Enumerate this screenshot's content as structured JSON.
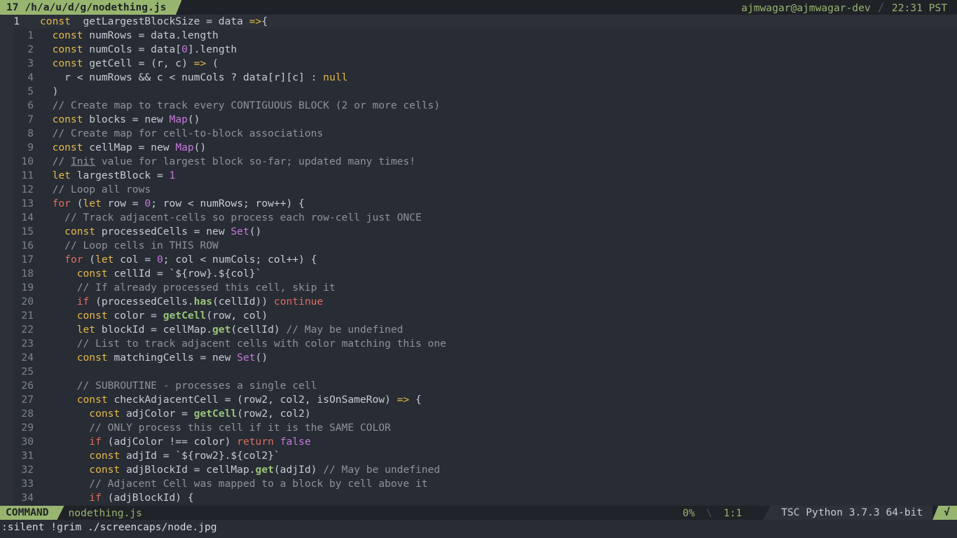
{
  "topbar": {
    "tab_label": "17 /h/a/u/d/g/nodething.js",
    "user_host": "ajmwagar@ajmwagar-dev",
    "separator": "/",
    "time": "22:31 PST"
  },
  "statusbar": {
    "mode": "COMMAND",
    "filename": "nodething.js",
    "percent": "0%",
    "separator": "\\",
    "position": "1:1",
    "lsp_info": "TSC Python 3.7.3 64-bit",
    "check": "√"
  },
  "command_line": ":silent !grim ./screencaps/node.jpg",
  "colors": {
    "accent_green": "#98b56f",
    "background": "#282c34",
    "keyword": "#e5b94a",
    "comment": "#8e939b",
    "number_class": "#c678dd",
    "control": "#e06c5f",
    "method": "#98c379"
  },
  "code": {
    "lines": [
      {
        "num": "1",
        "tokens": [
          [
            "kw",
            "const"
          ],
          [
            "",
            "  getLargestBlockSize = data "
          ],
          [
            "op",
            "=>"
          ],
          [
            "",
            "{"
          ]
        ]
      },
      {
        "num": "1",
        "tokens": [
          [
            "",
            "  "
          ],
          [
            "kw",
            "const"
          ],
          [
            "",
            " numRows = data.length"
          ]
        ]
      },
      {
        "num": "2",
        "tokens": [
          [
            "",
            "  "
          ],
          [
            "kw",
            "const"
          ],
          [
            "",
            " numCols = data["
          ],
          [
            "num",
            "0"
          ],
          [
            "",
            "].length"
          ]
        ]
      },
      {
        "num": "3",
        "tokens": [
          [
            "",
            "  "
          ],
          [
            "kw",
            "const"
          ],
          [
            "",
            " getCell = (r, c) "
          ],
          [
            "op",
            "=>"
          ],
          [
            "",
            " ("
          ]
        ]
      },
      {
        "num": "4",
        "tokens": [
          [
            "",
            "    r < numRows && c < numCols ? data[r][c] : "
          ],
          [
            "kw",
            "null"
          ]
        ]
      },
      {
        "num": "5",
        "tokens": [
          [
            "",
            "  )"
          ]
        ]
      },
      {
        "num": "6",
        "tokens": [
          [
            "",
            "  "
          ],
          [
            "cm",
            "// Create map to track every CONTIGUOUS BLOCK (2 or more cells)"
          ]
        ]
      },
      {
        "num": "7",
        "tokens": [
          [
            "",
            "  "
          ],
          [
            "kw",
            "const"
          ],
          [
            "",
            " blocks = new "
          ],
          [
            "cls",
            "Map"
          ],
          [
            "",
            "()"
          ]
        ]
      },
      {
        "num": "8",
        "tokens": [
          [
            "",
            "  "
          ],
          [
            "cm",
            "// Create map for cell-to-block associations"
          ]
        ]
      },
      {
        "num": "9",
        "tokens": [
          [
            "",
            "  "
          ],
          [
            "kw",
            "const"
          ],
          [
            "",
            " cellMap = new "
          ],
          [
            "cls",
            "Map"
          ],
          [
            "",
            "()"
          ]
        ]
      },
      {
        "num": "10",
        "tokens": [
          [
            "",
            "  "
          ],
          [
            "cm",
            "// "
          ],
          [
            "cm ul",
            "Init"
          ],
          [
            "cm",
            " value for largest block so-far; updated many times!"
          ]
        ]
      },
      {
        "num": "11",
        "tokens": [
          [
            "",
            "  "
          ],
          [
            "kw",
            "let"
          ],
          [
            "",
            " largestBlock = "
          ],
          [
            "num",
            "1"
          ]
        ]
      },
      {
        "num": "12",
        "tokens": [
          [
            "",
            "  "
          ],
          [
            "cm",
            "// Loop all rows"
          ]
        ]
      },
      {
        "num": "13",
        "tokens": [
          [
            "",
            "  "
          ],
          [
            "ctl",
            "for"
          ],
          [
            "",
            " ("
          ],
          [
            "kw",
            "let"
          ],
          [
            "",
            " row = "
          ],
          [
            "num",
            "0"
          ],
          [
            "",
            "; row < numRows; row++) {"
          ]
        ]
      },
      {
        "num": "14",
        "tokens": [
          [
            "",
            "    "
          ],
          [
            "cm",
            "// Track adjacent-cells so process each row-cell just ONCE"
          ]
        ]
      },
      {
        "num": "15",
        "tokens": [
          [
            "",
            "    "
          ],
          [
            "kw",
            "const"
          ],
          [
            "",
            " processedCells = new "
          ],
          [
            "cls",
            "Set"
          ],
          [
            "",
            "()"
          ]
        ]
      },
      {
        "num": "16",
        "tokens": [
          [
            "",
            "    "
          ],
          [
            "cm",
            "// Loop cells in THIS ROW"
          ]
        ]
      },
      {
        "num": "17",
        "tokens": [
          [
            "",
            "    "
          ],
          [
            "ctl",
            "for"
          ],
          [
            "",
            " ("
          ],
          [
            "kw",
            "let"
          ],
          [
            "",
            " col = "
          ],
          [
            "num",
            "0"
          ],
          [
            "",
            "; col < numCols; col++) {"
          ]
        ]
      },
      {
        "num": "18",
        "tokens": [
          [
            "",
            "      "
          ],
          [
            "kw",
            "const"
          ],
          [
            "",
            " cellId = `${row}.${col}`"
          ]
        ]
      },
      {
        "num": "19",
        "tokens": [
          [
            "",
            "      "
          ],
          [
            "cm",
            "// If already processed this cell, skip it"
          ]
        ]
      },
      {
        "num": "20",
        "tokens": [
          [
            "",
            "      "
          ],
          [
            "ctl",
            "if"
          ],
          [
            "",
            " (processedCells."
          ],
          [
            "method",
            "has"
          ],
          [
            "",
            "(cellId)) "
          ],
          [
            "ctl",
            "continue"
          ]
        ]
      },
      {
        "num": "21",
        "tokens": [
          [
            "",
            "      "
          ],
          [
            "kw",
            "const"
          ],
          [
            "",
            " color = "
          ],
          [
            "method",
            "getCell"
          ],
          [
            "",
            "(row, col)"
          ]
        ]
      },
      {
        "num": "22",
        "tokens": [
          [
            "",
            "      "
          ],
          [
            "kw",
            "let"
          ],
          [
            "",
            " blockId = cellMap."
          ],
          [
            "method",
            "get"
          ],
          [
            "",
            "(cellId) "
          ],
          [
            "cm",
            "// May be undefined"
          ]
        ]
      },
      {
        "num": "23",
        "tokens": [
          [
            "",
            "      "
          ],
          [
            "cm",
            "// List to track adjacent cells with color matching this one"
          ]
        ]
      },
      {
        "num": "24",
        "tokens": [
          [
            "",
            "      "
          ],
          [
            "kw",
            "const"
          ],
          [
            "",
            " matchingCells = new "
          ],
          [
            "cls",
            "Set"
          ],
          [
            "",
            "()"
          ]
        ]
      },
      {
        "num": "25",
        "tokens": []
      },
      {
        "num": "26",
        "tokens": [
          [
            "",
            "      "
          ],
          [
            "cm",
            "// SUBROUTINE - processes a single cell"
          ]
        ]
      },
      {
        "num": "27",
        "tokens": [
          [
            "",
            "      "
          ],
          [
            "kw",
            "const"
          ],
          [
            "",
            " checkAdjacentCell = (row2, col2, isOnSameRow) "
          ],
          [
            "op",
            "=>"
          ],
          [
            "",
            " {"
          ]
        ]
      },
      {
        "num": "28",
        "tokens": [
          [
            "",
            "        "
          ],
          [
            "kw",
            "const"
          ],
          [
            "",
            " adjColor = "
          ],
          [
            "method",
            "getCell"
          ],
          [
            "",
            "(row2, col2)"
          ]
        ]
      },
      {
        "num": "29",
        "tokens": [
          [
            "",
            "        "
          ],
          [
            "cm",
            "// ONLY process this cell if it is the SAME COLOR"
          ]
        ]
      },
      {
        "num": "30",
        "tokens": [
          [
            "",
            "        "
          ],
          [
            "ctl",
            "if"
          ],
          [
            "",
            " (adjColor !== color) "
          ],
          [
            "ctl",
            "return"
          ],
          [
            "",
            " "
          ],
          [
            "num",
            "false"
          ]
        ]
      },
      {
        "num": "31",
        "tokens": [
          [
            "",
            "        "
          ],
          [
            "kw",
            "const"
          ],
          [
            "",
            " adjId = `${row2}.${col2}`"
          ]
        ]
      },
      {
        "num": "32",
        "tokens": [
          [
            "",
            "        "
          ],
          [
            "kw",
            "const"
          ],
          [
            "",
            " adjBlockId = cellMap."
          ],
          [
            "method",
            "get"
          ],
          [
            "",
            "(adjId) "
          ],
          [
            "cm",
            "// May be undefined"
          ]
        ]
      },
      {
        "num": "33",
        "tokens": [
          [
            "",
            "        "
          ],
          [
            "cm",
            "// Adjacent Cell was mapped to a block by cell above it"
          ]
        ]
      },
      {
        "num": "34",
        "tokens": [
          [
            "",
            "        "
          ],
          [
            "ctl",
            "if"
          ],
          [
            "",
            " (adjBlockId) {"
          ]
        ]
      }
    ]
  }
}
